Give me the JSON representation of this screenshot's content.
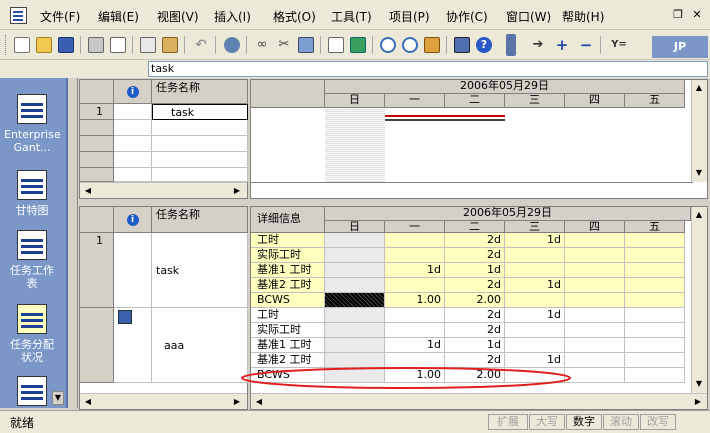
{
  "menu": {
    "items": [
      "文件(F)",
      "编辑(E)",
      "视图(V)",
      "插入(I)",
      "格式(O)",
      "工具(T)",
      "项目(P)",
      "协作(C)",
      "窗口(W)",
      "帮助(H)"
    ]
  },
  "entry": {
    "value": "task"
  },
  "logo": {
    "text": "JP"
  },
  "viewbar": {
    "items": [
      {
        "label": "Enterprise Gant...",
        "icon": "gantt-chart-icon"
      },
      {
        "label": "甘特图",
        "icon": "gantt-chart-icon"
      },
      {
        "label": "任务工作表",
        "icon": "task-sheet-icon"
      },
      {
        "label": "任务分配状况",
        "icon": "task-usage-icon"
      },
      {
        "label": "",
        "icon": "gantt-chart-icon"
      }
    ]
  },
  "top_table": {
    "col_name": "任务名称",
    "rows": [
      {
        "id": "1",
        "name": "task"
      }
    ]
  },
  "timescale": {
    "week": "2006年05月29日",
    "days": [
      "日",
      "一",
      "二",
      "三",
      "四",
      "五"
    ]
  },
  "usage": {
    "col_name": "任务名称",
    "detail_header": "详细信息",
    "tasks": [
      {
        "id": "1",
        "name": "task",
        "indicator": false,
        "rows": [
          {
            "label": "工时",
            "vals": [
              "",
              "",
              "2d",
              "1d",
              "",
              ""
            ]
          },
          {
            "label": "实际工时",
            "vals": [
              "",
              "",
              "2d",
              "",
              "",
              ""
            ]
          },
          {
            "label": "基准1 工时",
            "vals": [
              "",
              "1d",
              "1d",
              "",
              "",
              ""
            ]
          },
          {
            "label": "基准2 工时",
            "vals": [
              "",
              "",
              "2d",
              "1d",
              "",
              ""
            ]
          },
          {
            "label": "BCWS",
            "vals": [
              "",
              "1.00",
              "2.00",
              "",
              "",
              ""
            ]
          }
        ]
      },
      {
        "id": "",
        "name": "aaa",
        "indicator": true,
        "rows": [
          {
            "label": "工时",
            "vals": [
              "",
              "",
              "2d",
              "1d",
              "",
              ""
            ]
          },
          {
            "label": "实际工时",
            "vals": [
              "",
              "",
              "2d",
              "",
              "",
              ""
            ]
          },
          {
            "label": "基准1 工时",
            "vals": [
              "",
              "1d",
              "1d",
              "",
              "",
              ""
            ]
          },
          {
            "label": "基准2 工时",
            "vals": [
              "",
              "",
              "2d",
              "1d",
              "",
              ""
            ]
          },
          {
            "label": "BCWS",
            "vals": [
              "",
              "1.00",
              "2.00",
              "",
              "",
              ""
            ]
          }
        ]
      }
    ]
  },
  "status": {
    "ready": "就绪",
    "indicators": [
      "扩展",
      "大写",
      "数字",
      "滚动",
      "改写"
    ],
    "active_index": 2
  },
  "colors": {
    "highlight_ellipse": "#e02020",
    "viewbar": "#7a97c8",
    "gantt_bar": "#c00000"
  }
}
